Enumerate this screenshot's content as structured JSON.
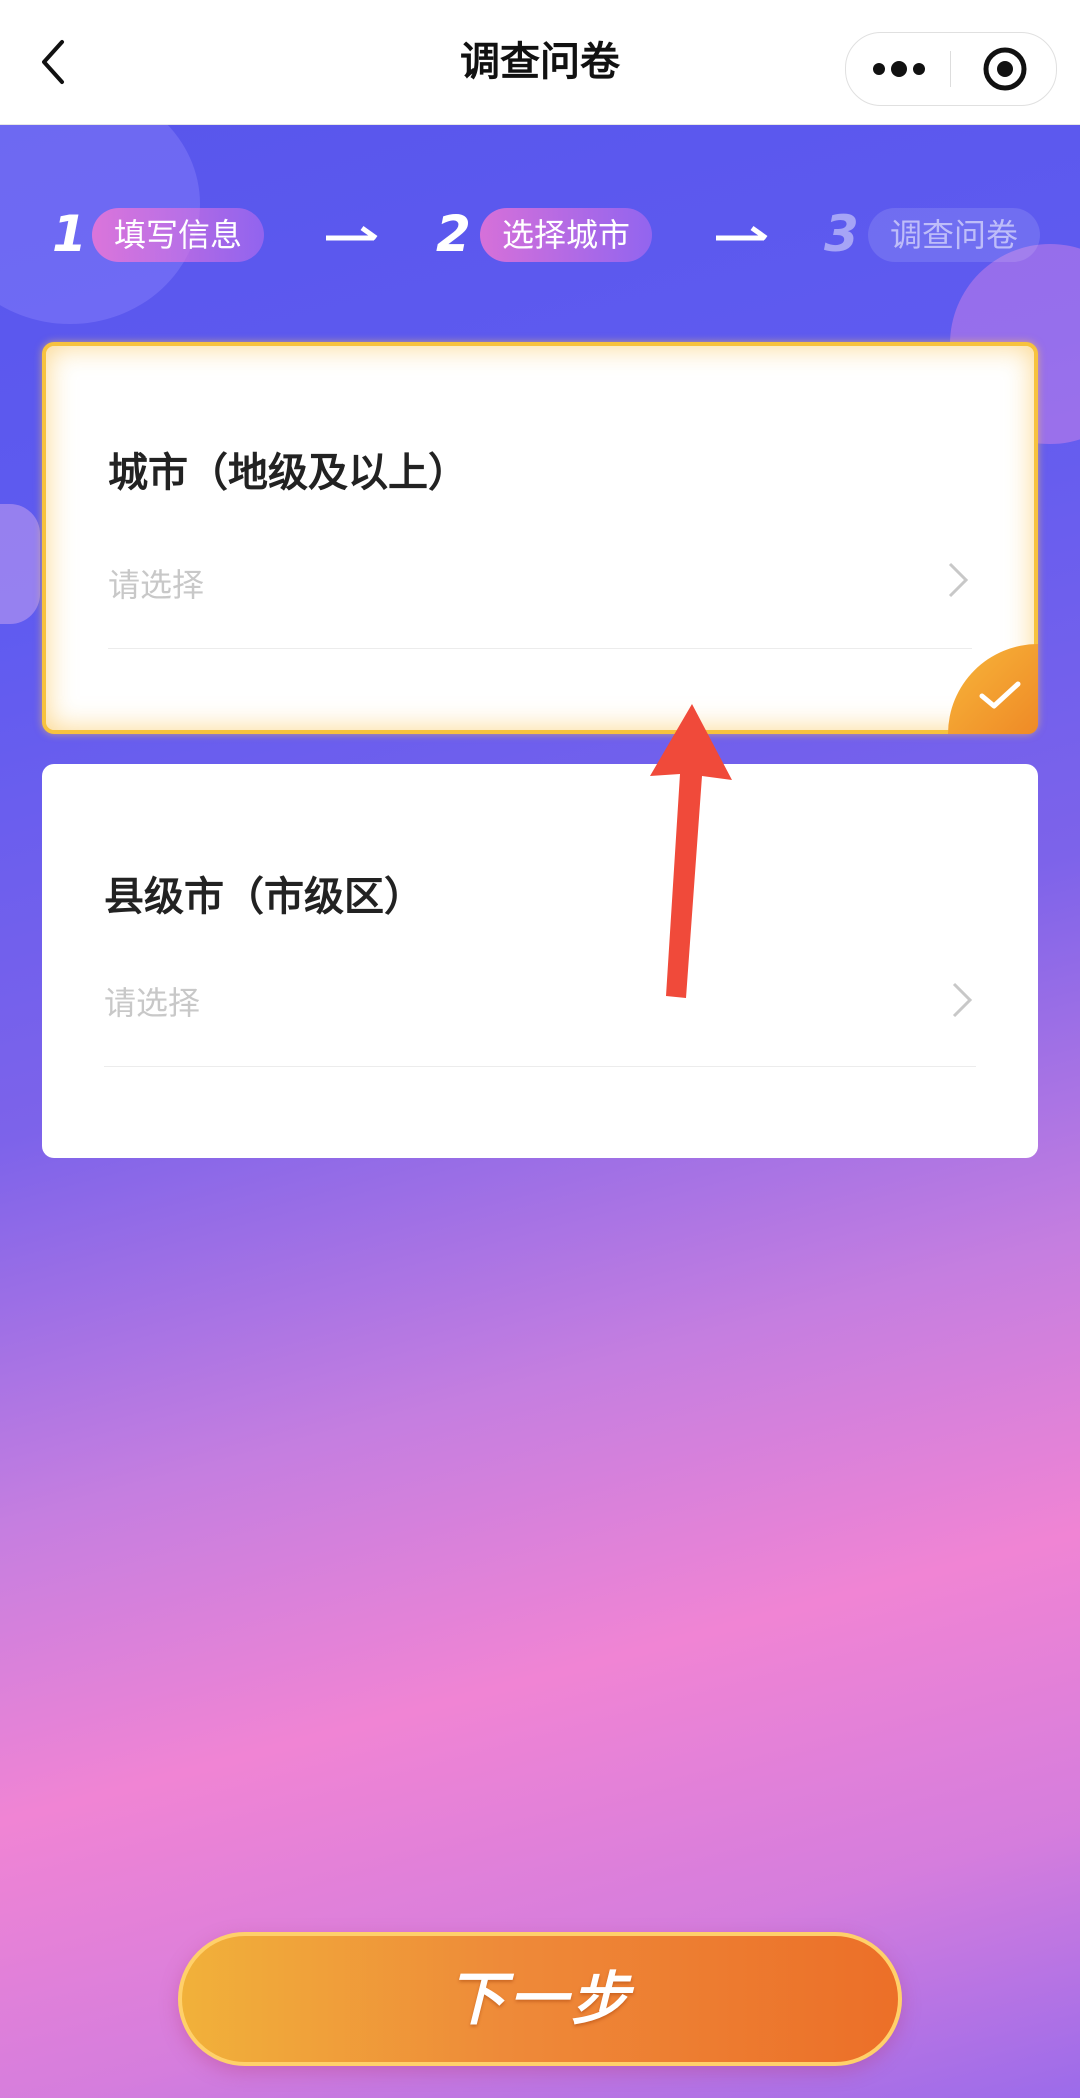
{
  "navbar": {
    "title": "调查问卷",
    "back_icon": "chevron-left-icon",
    "more_icon": "more-dots-icon",
    "target_icon": "target-icon"
  },
  "steps": [
    {
      "number": "1",
      "label": "填写信息",
      "state": "done"
    },
    {
      "number": "2",
      "label": "选择城市",
      "state": "current"
    },
    {
      "number": "3",
      "label": "调查问卷",
      "state": "upcoming"
    }
  ],
  "cards": [
    {
      "title": "城市（地级及以上）",
      "placeholder": "请选择",
      "selected": true
    },
    {
      "title": "县级市（市级区）",
      "placeholder": "请选择",
      "selected": false
    }
  ],
  "next_button": {
    "label": "下一步"
  },
  "colors": {
    "accent": "#f7c23e",
    "annotation_arrow": "#f04a3a",
    "button_orange": "#ec6f28"
  }
}
